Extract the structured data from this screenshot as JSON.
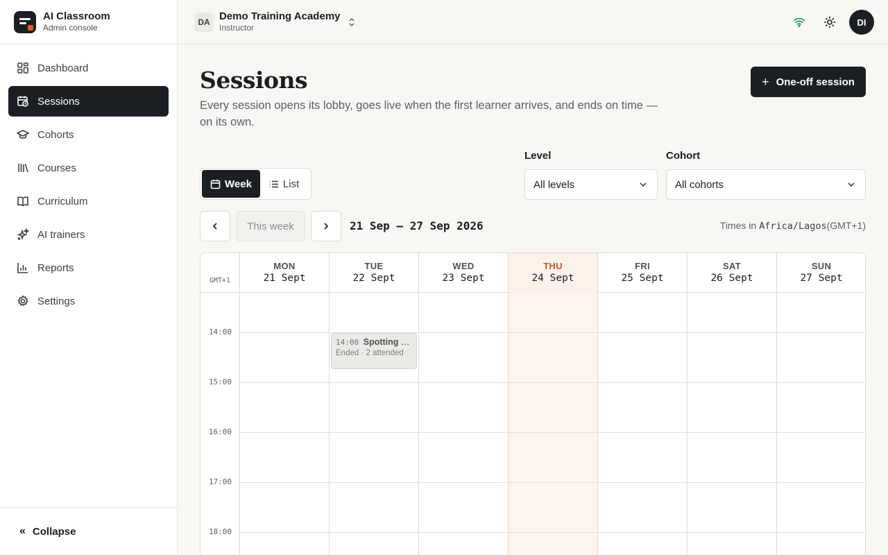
{
  "brand": {
    "title": "AI Classroom",
    "subtitle": "Admin console"
  },
  "sidebar": {
    "items": [
      {
        "label": "Dashboard",
        "icon": "dashboard-icon"
      },
      {
        "label": "Sessions",
        "icon": "calendar-clock-icon",
        "active": true
      },
      {
        "label": "Cohorts",
        "icon": "graduation-cap-icon"
      },
      {
        "label": "Courses",
        "icon": "library-icon"
      },
      {
        "label": "Curriculum",
        "icon": "book-open-icon"
      },
      {
        "label": "AI trainers",
        "icon": "sparkles-icon"
      },
      {
        "label": "Reports",
        "icon": "bar-chart-icon"
      },
      {
        "label": "Settings",
        "icon": "gear-icon"
      }
    ],
    "collapse_label": "Collapse"
  },
  "topbar": {
    "org_initials": "DA",
    "org_name": "Demo Training Academy",
    "org_role": "Instructor",
    "avatar_initials": "DI"
  },
  "page": {
    "title": "Sessions",
    "description": "Every session opens its lobby, goes live when the first learner arrives, and ends on time — on its own.",
    "primary_action": "One-off session"
  },
  "view_toggle": {
    "week": "Week",
    "list": "List",
    "selected": "Week"
  },
  "filters": {
    "level_label": "Level",
    "level_value": "All levels",
    "cohort_label": "Cohort",
    "cohort_value": "All cohorts"
  },
  "week_nav": {
    "this_week": "This week",
    "range": "21 Sep – 27 Sep 2026",
    "tz_prefix": "Times in",
    "tz_name": "Africa/Lagos",
    "tz_offset": "(GMT+1)"
  },
  "calendar": {
    "gmt_label": "GMT+1",
    "days": [
      {
        "dow": "MON",
        "date": "21 Sept"
      },
      {
        "dow": "TUE",
        "date": "22 Sept"
      },
      {
        "dow": "WED",
        "date": "23 Sept"
      },
      {
        "dow": "THU",
        "date": "24 Sept",
        "today": true
      },
      {
        "dow": "FRI",
        "date": "25 Sept"
      },
      {
        "dow": "SAT",
        "date": "26 Sept"
      },
      {
        "dow": "SUN",
        "date": "27 Sept"
      }
    ],
    "hours": [
      "14:00",
      "15:00",
      "16:00",
      "17:00",
      "18:00"
    ],
    "events": [
      {
        "day": "TUE",
        "time": "14:00",
        "title": "Spotting a …",
        "meta": "Ended · 2 attended"
      }
    ]
  },
  "colors": {
    "accent": "#1b1f24",
    "today": "#c8542a",
    "brand_dot": "#e0592a",
    "online": "#2e9e5b"
  }
}
